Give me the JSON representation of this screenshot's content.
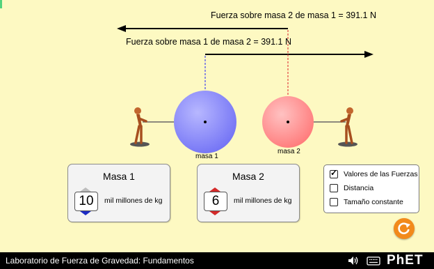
{
  "app": {
    "footer_title": "Laboratorio de Fuerza de Gravedad: Fundamentos",
    "brand": "PhET"
  },
  "forces": {
    "on_mass2_label": "Fuerza sobre masa 2 de masa 1 = 391.1 N",
    "on_mass1_label": "Fuerza sobre masa 1 de masa 2 = 391.1 N"
  },
  "masses": [
    {
      "label": "masa 1",
      "color": "#8d8dff",
      "panel_title": "Masa 1",
      "value": "10",
      "unit": "mil millones de kg",
      "spinner_color": "#1d2cc4"
    },
    {
      "label": "masa 2",
      "color": "#ff8f8f",
      "panel_title": "Masa 2",
      "value": "6",
      "unit": "mil millones de kg",
      "spinner_color": "#d42a2a"
    }
  ],
  "options": [
    {
      "label": "Valores de las Fuerzas",
      "checked": true
    },
    {
      "label": "Distancia",
      "checked": false
    },
    {
      "label": "Tamaño constante",
      "checked": false
    }
  ],
  "icons": {
    "reset": "reset-icon",
    "sound": "sound-icon",
    "keyboard": "keyboard-icon"
  },
  "colors": {
    "background": "#fdf9c2",
    "footer": "#000000",
    "reset": "#f28a1b"
  }
}
